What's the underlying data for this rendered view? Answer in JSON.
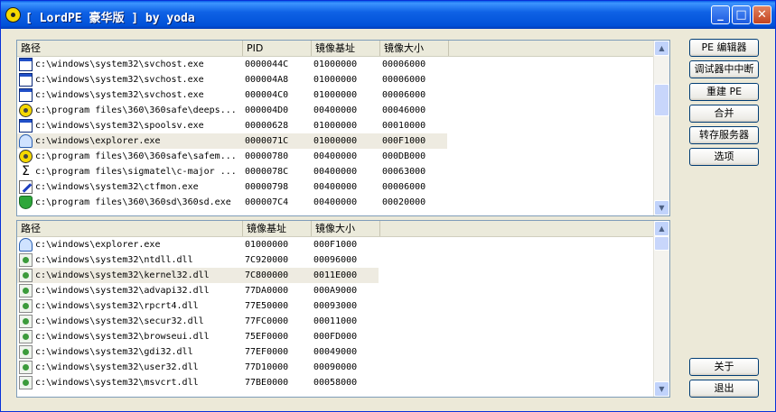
{
  "window": {
    "title": "[ LordPE 豪华版 ] by yoda",
    "controls": {
      "minimize": "_",
      "maximize": "□",
      "close": "✕"
    }
  },
  "process_list": {
    "columns": [
      "路径",
      "PID",
      "镜像基址",
      "镜像大小"
    ],
    "rows": [
      {
        "icon": "window-icon",
        "path": "c:\\windows\\system32\\svchost.exe",
        "pid": "0000044C",
        "base": "01000000",
        "size": "00006000",
        "selected": false
      },
      {
        "icon": "window-icon",
        "path": "c:\\windows\\system32\\svchost.exe",
        "pid": "000004A8",
        "base": "01000000",
        "size": "00006000",
        "selected": false
      },
      {
        "icon": "window-icon",
        "path": "c:\\windows\\system32\\svchost.exe",
        "pid": "000004C0",
        "base": "01000000",
        "size": "00006000",
        "selected": false
      },
      {
        "icon": "360-icon",
        "path": "c:\\program files\\360\\360safe\\deeps...",
        "pid": "000004D0",
        "base": "00400000",
        "size": "00046000",
        "selected": false
      },
      {
        "icon": "window-icon",
        "path": "c:\\windows\\system32\\spoolsv.exe",
        "pid": "00000628",
        "base": "01000000",
        "size": "00010000",
        "selected": false
      },
      {
        "icon": "monitor-icon",
        "path": "c:\\windows\\explorer.exe",
        "pid": "0000071C",
        "base": "01000000",
        "size": "000F1000",
        "selected": true
      },
      {
        "icon": "360-icon",
        "path": "c:\\program files\\360\\360safe\\safem...",
        "pid": "00000780",
        "base": "00400000",
        "size": "000DB000",
        "selected": false
      },
      {
        "icon": "sigma-icon",
        "path": "c:\\program files\\sigmatel\\c-major ...",
        "pid": "0000078C",
        "base": "00400000",
        "size": "00063000",
        "selected": false
      },
      {
        "icon": "pen-icon",
        "path": "c:\\windows\\system32\\ctfmon.exe",
        "pid": "00000798",
        "base": "00400000",
        "size": "00006000",
        "selected": false
      },
      {
        "icon": "shield-icon",
        "path": "c:\\program files\\360\\360sd\\360sd.exe",
        "pid": "000007C4",
        "base": "00400000",
        "size": "00020000",
        "selected": false
      }
    ],
    "scroll": {
      "up": "▲",
      "down": "▼"
    }
  },
  "module_list": {
    "columns": [
      "路径",
      "镜像基址",
      "镜像大小"
    ],
    "rows": [
      {
        "icon": "monitor-icon",
        "path": "c:\\windows\\explorer.exe",
        "base": "01000000",
        "size": "000F1000",
        "selected": false
      },
      {
        "icon": "dll-icon",
        "path": "c:\\windows\\system32\\ntdll.dll",
        "base": "7C920000",
        "size": "00096000",
        "selected": false
      },
      {
        "icon": "dll-icon",
        "path": "c:\\windows\\system32\\kernel32.dll",
        "base": "7C800000",
        "size": "0011E000",
        "selected": true
      },
      {
        "icon": "dll-icon",
        "path": "c:\\windows\\system32\\advapi32.dll",
        "base": "77DA0000",
        "size": "000A9000",
        "selected": false
      },
      {
        "icon": "dll-icon",
        "path": "c:\\windows\\system32\\rpcrt4.dll",
        "base": "77E50000",
        "size": "00093000",
        "selected": false
      },
      {
        "icon": "dll-icon",
        "path": "c:\\windows\\system32\\secur32.dll",
        "base": "77FC0000",
        "size": "00011000",
        "selected": false
      },
      {
        "icon": "dll-icon",
        "path": "c:\\windows\\system32\\browseui.dll",
        "base": "75EF0000",
        "size": "000FD000",
        "selected": false
      },
      {
        "icon": "dll-icon",
        "path": "c:\\windows\\system32\\gdi32.dll",
        "base": "77EF0000",
        "size": "00049000",
        "selected": false
      },
      {
        "icon": "dll-icon",
        "path": "c:\\windows\\system32\\user32.dll",
        "base": "77D10000",
        "size": "00090000",
        "selected": false
      },
      {
        "icon": "dll-icon",
        "path": "c:\\windows\\system32\\msvcrt.dll",
        "base": "77BE0000",
        "size": "00058000",
        "selected": false
      }
    ],
    "scroll": {
      "up": "▲",
      "down": "▼"
    }
  },
  "actions": {
    "pe_editor": "PE 编辑器",
    "debugger_break": "调试器中中断",
    "rebuild_pe": "重建 PE",
    "merge": "合并",
    "dump_server": "转存服务器",
    "options": "选项",
    "about": "关于",
    "exit": "退出"
  }
}
